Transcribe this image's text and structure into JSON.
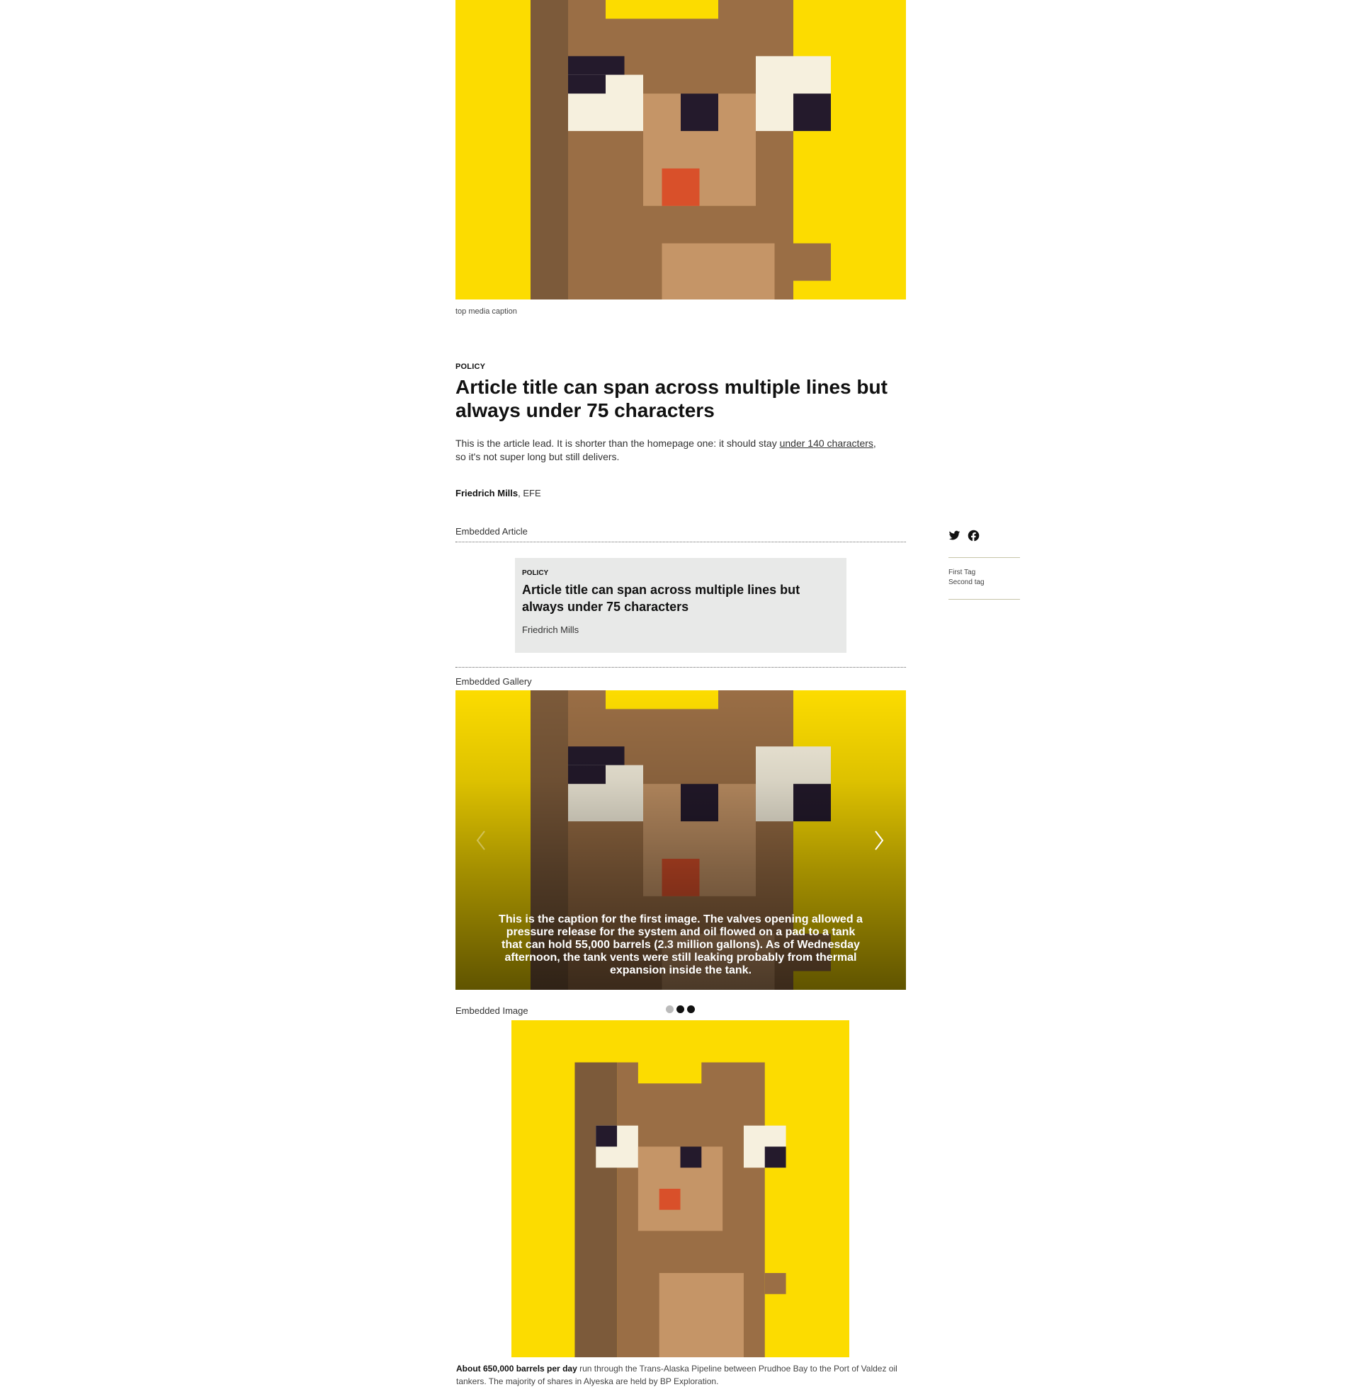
{
  "top_media": {
    "caption": "top media caption"
  },
  "article": {
    "category": "POLICY",
    "title": "Article title can span across multiple lines but always under 75 characters",
    "lead_before": "This is the article lead. It is shorter than the homepage one: it should stay ",
    "lead_link": "under 140 characters",
    "lead_after": ", so it's not super long but still delivers.",
    "author": "Friedrich Mills",
    "agency": ", EFE"
  },
  "embedded_article": {
    "section_label": "Embedded Article",
    "category": "POLICY",
    "title": "Article title can span across multiple lines but always under 75 characters",
    "author": "Friedrich Mills"
  },
  "embedded_gallery": {
    "section_label": "Embedded Gallery",
    "caption": "This is the caption for the first image. The valves opening allowed a pressure release for the system and oil flowed on a pad to a tank that can hold 55,000 barrels (2.3 million gallons). As of Wednesday afternoon, the tank vents were still leaking probably from thermal expansion inside the tank.",
    "slide_count": 3,
    "active_slide": 1,
    "prev_icon": "chevron-left-icon",
    "next_icon": "chevron-right-icon"
  },
  "embedded_image": {
    "section_label": "Embedded Image",
    "caption_bold": "About 650,000 barrels per day",
    "caption_rest": " run through the Trans-Alaska Pipeline between Prudhoe Bay to the Port of Valdez oil tankers. The majority of shares in Alyeska are held by BP Exploration."
  },
  "sidebar": {
    "share_icons": [
      "twitter-icon",
      "facebook-icon"
    ],
    "tags": [
      "First Tag",
      "Second tag"
    ]
  },
  "colors": {
    "art_yellow": "#fcdc00",
    "art_brown": "#9a6e45",
    "art_dark_brown": "#7c5a3a",
    "art_tan": "#c59567",
    "art_eye_white": "#f6f0de",
    "art_pupil": "#241a2c",
    "art_tongue": "#d9502a",
    "card_bg": "#e8e9e8",
    "tag_rule": "#c6c4a8"
  }
}
